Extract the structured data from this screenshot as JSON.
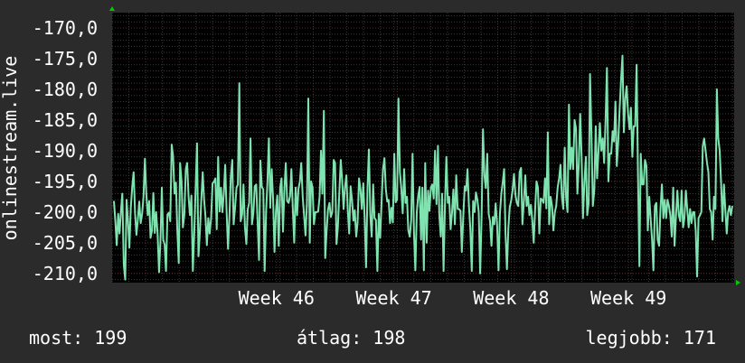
{
  "colors": {
    "background": "#2b2b2b",
    "plot_background": "#000000",
    "grid_major": "#5a2a2a",
    "grid_minor": "#3a3a3a",
    "series_line": "#7fe3b0",
    "axis_arrow": "#00cc00"
  },
  "footer": {
    "now_label": "most:",
    "now_value": "199",
    "avg_label": "átlag:",
    "avg_value": "198",
    "best_label": "legjobb:",
    "best_value": "171"
  },
  "chart_data": {
    "type": "line",
    "title": "",
    "ylabel": "onlinestream.live",
    "ylim": [
      -211.5,
      -167.5
    ],
    "yticks": [
      -170,
      -175,
      -180,
      -185,
      -190,
      -195,
      -200,
      -205,
      -210
    ],
    "ytick_labels": [
      "-170,0",
      "-175,0",
      "-180,0",
      "-185,0",
      "-190,0",
      "-195,0",
      "-200,0",
      "-205,0",
      "-210,0"
    ],
    "xlim": [
      44.6,
      49.9
    ],
    "xticks": [
      46,
      47,
      48,
      49
    ],
    "xtick_labels": [
      "Week 46",
      "Week 47",
      "Week 48",
      "Week 49"
    ],
    "grid": true,
    "series": [
      {
        "values": [
          -198.2,
          -201.5,
          -205.4,
          -200.3,
          -203.5,
          -199.8,
          -197.0,
          -208.5,
          -211.0,
          -198.0,
          -201.5,
          -205.8,
          -199.2,
          -195.8,
          -193.5,
          -200.2,
          -203.7,
          -201.2,
          -198.3,
          -201.8,
          -200.3,
          -197.5,
          -191.3,
          -197.0,
          -200.5,
          -198.2,
          -204.2,
          -203.0,
          -196.9,
          -203.4,
          -200.0,
          -203.5,
          -209.8,
          -205.0,
          -196.0,
          -204.5,
          -205.3,
          -209.6,
          -200.4,
          -200.1,
          -201.5,
          -189.0,
          -190.8,
          -197.0,
          -195.2,
          -203.0,
          -208.3,
          -192.0,
          -195.0,
          -202.5,
          -200.4,
          -193.0,
          -192.0,
          -197.6,
          -200.5,
          -197.3,
          -209.6,
          -203.7,
          -196.0,
          -188.8,
          -207.2,
          -203.5,
          -198.2,
          -193.5,
          -197.9,
          -200.8,
          -205.4,
          -201.0,
          -203.5,
          -201.0,
          -195.3,
          -195.1,
          -194.5,
          -202.8,
          -191.0,
          -199.9,
          -196.0,
          -200.0,
          -197.0,
          -192.3,
          -199.8,
          -206.0,
          -200.5,
          -194.2,
          -191.5,
          -202.0,
          -199.3,
          -196.0,
          -195.5,
          -179.0,
          -201.5,
          -200.4,
          -195.5,
          -202.5,
          -205.2,
          -199.6,
          -198.5,
          -188.0,
          -202.0,
          -200.1,
          -195.8,
          -195.5,
          -201.5,
          -207.8,
          -191.6,
          -195.9,
          -196.3,
          -209.6,
          -200.0,
          -195.1,
          -188.0,
          -199.3,
          -193.0,
          -198.0,
          -206.5,
          -199.8,
          -197.3,
          -205.5,
          -196.0,
          -194.5,
          -203.2,
          -196.5,
          -192.0,
          -198.2,
          -198.5,
          -197.4,
          -193.0,
          -199.7,
          -205.0,
          -196.0,
          -200.5,
          -196.2,
          -195.0,
          -192.0,
          -197.5,
          -200.5,
          -203.8,
          -198.5,
          -181.5,
          -205.0,
          -195.0,
          -196.0,
          -202.0,
          -200.0,
          -200.0,
          -199.9,
          -197.5,
          -190.0,
          -197.0,
          -183.5,
          -207.5,
          -203.0,
          -199.6,
          -198.5,
          -200.8,
          -200.0,
          -191.5,
          -192.0,
          -205.2,
          -202.5,
          -196.8,
          -191.5,
          -194.8,
          -199.5,
          -196.0,
          -194.0,
          -199.5,
          -203.5,
          -195.8,
          -197.9,
          -201.4,
          -199.7,
          -204.0,
          -201.7,
          -194.5,
          -196.3,
          -199.5,
          -195.3,
          -200.9,
          -209.0,
          -196.0,
          -189.8,
          -200.5,
          -204.0,
          -195.5,
          -201.0,
          -201.3,
          -209.6,
          -200.3,
          -204.2,
          -198.5,
          -193.0,
          -191.2,
          -196.2,
          -198.3,
          -198.0,
          -201.8,
          -199.3,
          -201.7,
          -190.5,
          -198.4,
          -198.0,
          -181.5,
          -193.5,
          -196.0,
          -200.2,
          -193.0,
          -198.5,
          -197.5,
          -203.0,
          -204.0,
          -201.3,
          -190.5,
          -203.5,
          -209.5,
          -200.0,
          -197.4,
          -195.9,
          -204.5,
          -196.0,
          -209.5,
          -192.0,
          -205.0,
          -196.5,
          -199.8,
          -196.0,
          -195.5,
          -197.8,
          -190.0,
          -198.7,
          -189.2,
          -200.5,
          -204.0,
          -197.0,
          -209.6,
          -198.5,
          -191.0,
          -198.5,
          -197.5,
          -202.8,
          -200.2,
          -196.3,
          -202.0,
          -194.0,
          -199.5,
          -199.5,
          -199.8,
          -206.5,
          -200.7,
          -195.8,
          -196.5,
          -193.0,
          -198.8,
          -202.7,
          -209.6,
          -198.2,
          -200.0,
          -196.8,
          -198.0,
          -200.0,
          -210.0,
          -200.5,
          -186.5,
          -194.0,
          -196.1,
          -190.5,
          -200.3,
          -201.5,
          -205.5,
          -200.8,
          -202.0,
          -198.6,
          -202.0,
          -209.5,
          -200.3,
          -197.0,
          -195.2,
          -193.0,
          -203.5,
          -209.3,
          -202.5,
          -199.2,
          -198.1,
          -196.5,
          -193.8,
          -197.2,
          -198.5,
          -199.0,
          -193.5,
          -192.8,
          -202.0,
          -198.3,
          -194.0,
          -199.0,
          -197.5,
          -200.5,
          -198.8,
          -201.5,
          -205.0,
          -199.5,
          -195.0,
          -196.0,
          -203.5,
          -197.8,
          -198.0,
          -198.5,
          -194.5,
          -199.4,
          -187.0,
          -202.0,
          -197.5,
          -199.0,
          -203.0,
          -200.0,
          -199.0,
          -196.0,
          -194.5,
          -192.3,
          -197.6,
          -199.5,
          -189.5,
          -197.5,
          -200.0,
          -182.5,
          -193.0,
          -189.5,
          -193.0,
          -185.0,
          -186.4,
          -197.0,
          -192.0,
          -184.0,
          -191.0,
          -201.0,
          -195.0,
          -191.0,
          -200.5,
          -198.5,
          -177.5,
          -187.5,
          -199.0,
          -196.5,
          -186.0,
          -194.5,
          -190.0,
          -185.5,
          -190.0,
          -188.0,
          -192.0,
          -185.0,
          -176.5,
          -195.0,
          -190.5,
          -190.5,
          -186.8,
          -188.5,
          -182.0,
          -192.5,
          -188.5,
          -183.0,
          -178.5,
          -174.5,
          -187.0,
          -181.5,
          -179.5,
          -184.0,
          -186.5,
          -183.0,
          -191.0,
          -186.0,
          -186.0,
          -176.0,
          -193.5,
          -208.8,
          -190.5,
          -195.5,
          -195.5,
          -191.5,
          -192.5,
          -203.0,
          -197.5,
          -201.0,
          -204.5,
          -209.5,
          -199.0,
          -198.5,
          -204.5,
          -205.5,
          -199.5,
          -195.5,
          -201.0,
          -198.0,
          -201.0,
          -198.0,
          -199.0,
          -200.5,
          -204.0,
          -196.0,
          -205.5,
          -200.5,
          -196.5,
          -200.5,
          -201.5,
          -196.5,
          -202.5,
          -201.0,
          -196.5,
          -199.5,
          -202.5,
          -199.5,
          -201.8,
          -200.0,
          -200.0,
          -203.0,
          -210.5,
          -201.0,
          -200.5,
          -200.0,
          -189.3,
          -188.0,
          -190.0,
          -192.0,
          -193.5,
          -199.5,
          -200.0,
          -204.5,
          -197.5,
          -199.5,
          -180.0,
          -188.0,
          -190.0,
          -195.0,
          -201.5,
          -195.5,
          -199.5,
          -203.5,
          -200.0,
          -199.0,
          -200.5,
          -199.0
        ]
      }
    ]
  }
}
